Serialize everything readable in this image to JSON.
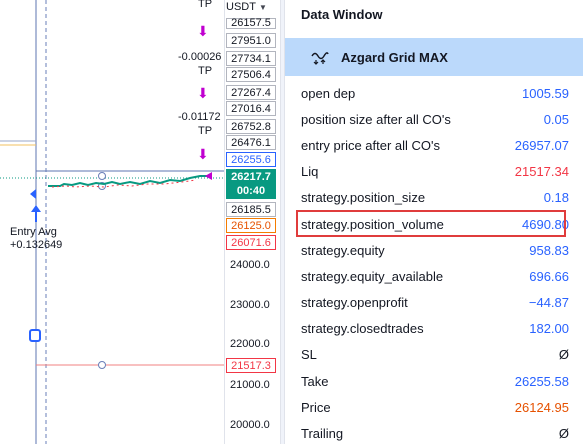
{
  "axis": {
    "unit": "USDT",
    "price_labels": [
      {
        "text": "26157.5",
        "style": "boxed"
      },
      {
        "text": "27951.0",
        "style": "boxed"
      },
      {
        "text": "27734.1",
        "style": "boxed"
      },
      {
        "text": "27506.4",
        "style": "boxed"
      },
      {
        "text": "27267.4",
        "style": "boxed"
      },
      {
        "text": "27016.4",
        "style": "boxed"
      },
      {
        "text": "26752.8",
        "style": "boxed"
      },
      {
        "text": "26476.1",
        "style": "boxed"
      },
      {
        "text": "26255.6",
        "style": "blue"
      },
      {
        "text": "26185.5",
        "style": "boxed"
      },
      {
        "text": "26125.0",
        "style": "orange"
      },
      {
        "text": "26071.6",
        "style": "red"
      }
    ],
    "current_price": "26217.7",
    "countdown": "00:40",
    "ticks": [
      "24000.0",
      "23000.0",
      "22000.0",
      "21000.0",
      "20000.0"
    ],
    "liq_label": "21517.3"
  },
  "chart": {
    "tp_labels": [
      {
        "value": "-0.00026",
        "tag": "TP"
      },
      {
        "value": "-0.01172",
        "tag": "TP"
      }
    ],
    "top_tp_partial": "TP",
    "entry": {
      "title": "Entry Avg",
      "value": "+0.132649"
    }
  },
  "panel": {
    "title": "Data Window",
    "indicator": "Azgard Grid MAX",
    "rows": [
      {
        "label": "open dep",
        "value": "1005.59",
        "color": "#2962ff"
      },
      {
        "label": "position size after all CO's",
        "value": "0.05",
        "color": "#2962ff"
      },
      {
        "label": "entry price after all CO's",
        "value": "26957.07",
        "color": "#2962ff"
      },
      {
        "label": "Liq",
        "value": "21517.34",
        "color": "#f23645"
      },
      {
        "label": "strategy.position_size",
        "value": "0.18",
        "color": "#2962ff"
      },
      {
        "label": "strategy.position_volume",
        "value": "4690.80",
        "color": "#2962ff",
        "highlight": true
      },
      {
        "label": "strategy.equity",
        "value": "958.83",
        "color": "#2962ff"
      },
      {
        "label": "strategy.equity_available",
        "value": "696.66",
        "color": "#2962ff"
      },
      {
        "label": "strategy.openprofit",
        "value": "−44.87",
        "color": "#2962ff"
      },
      {
        "label": "strategy.closedtrades",
        "value": "182.00",
        "color": "#2962ff"
      },
      {
        "label": "SL",
        "value": "Ø",
        "color": "#131722"
      },
      {
        "label": "Take",
        "value": "26255.58",
        "color": "#2962ff"
      },
      {
        "label": "Price",
        "value": "26124.95",
        "color": "#e65100"
      },
      {
        "label": "Trailing",
        "value": "Ø",
        "color": "#131722"
      }
    ]
  }
}
